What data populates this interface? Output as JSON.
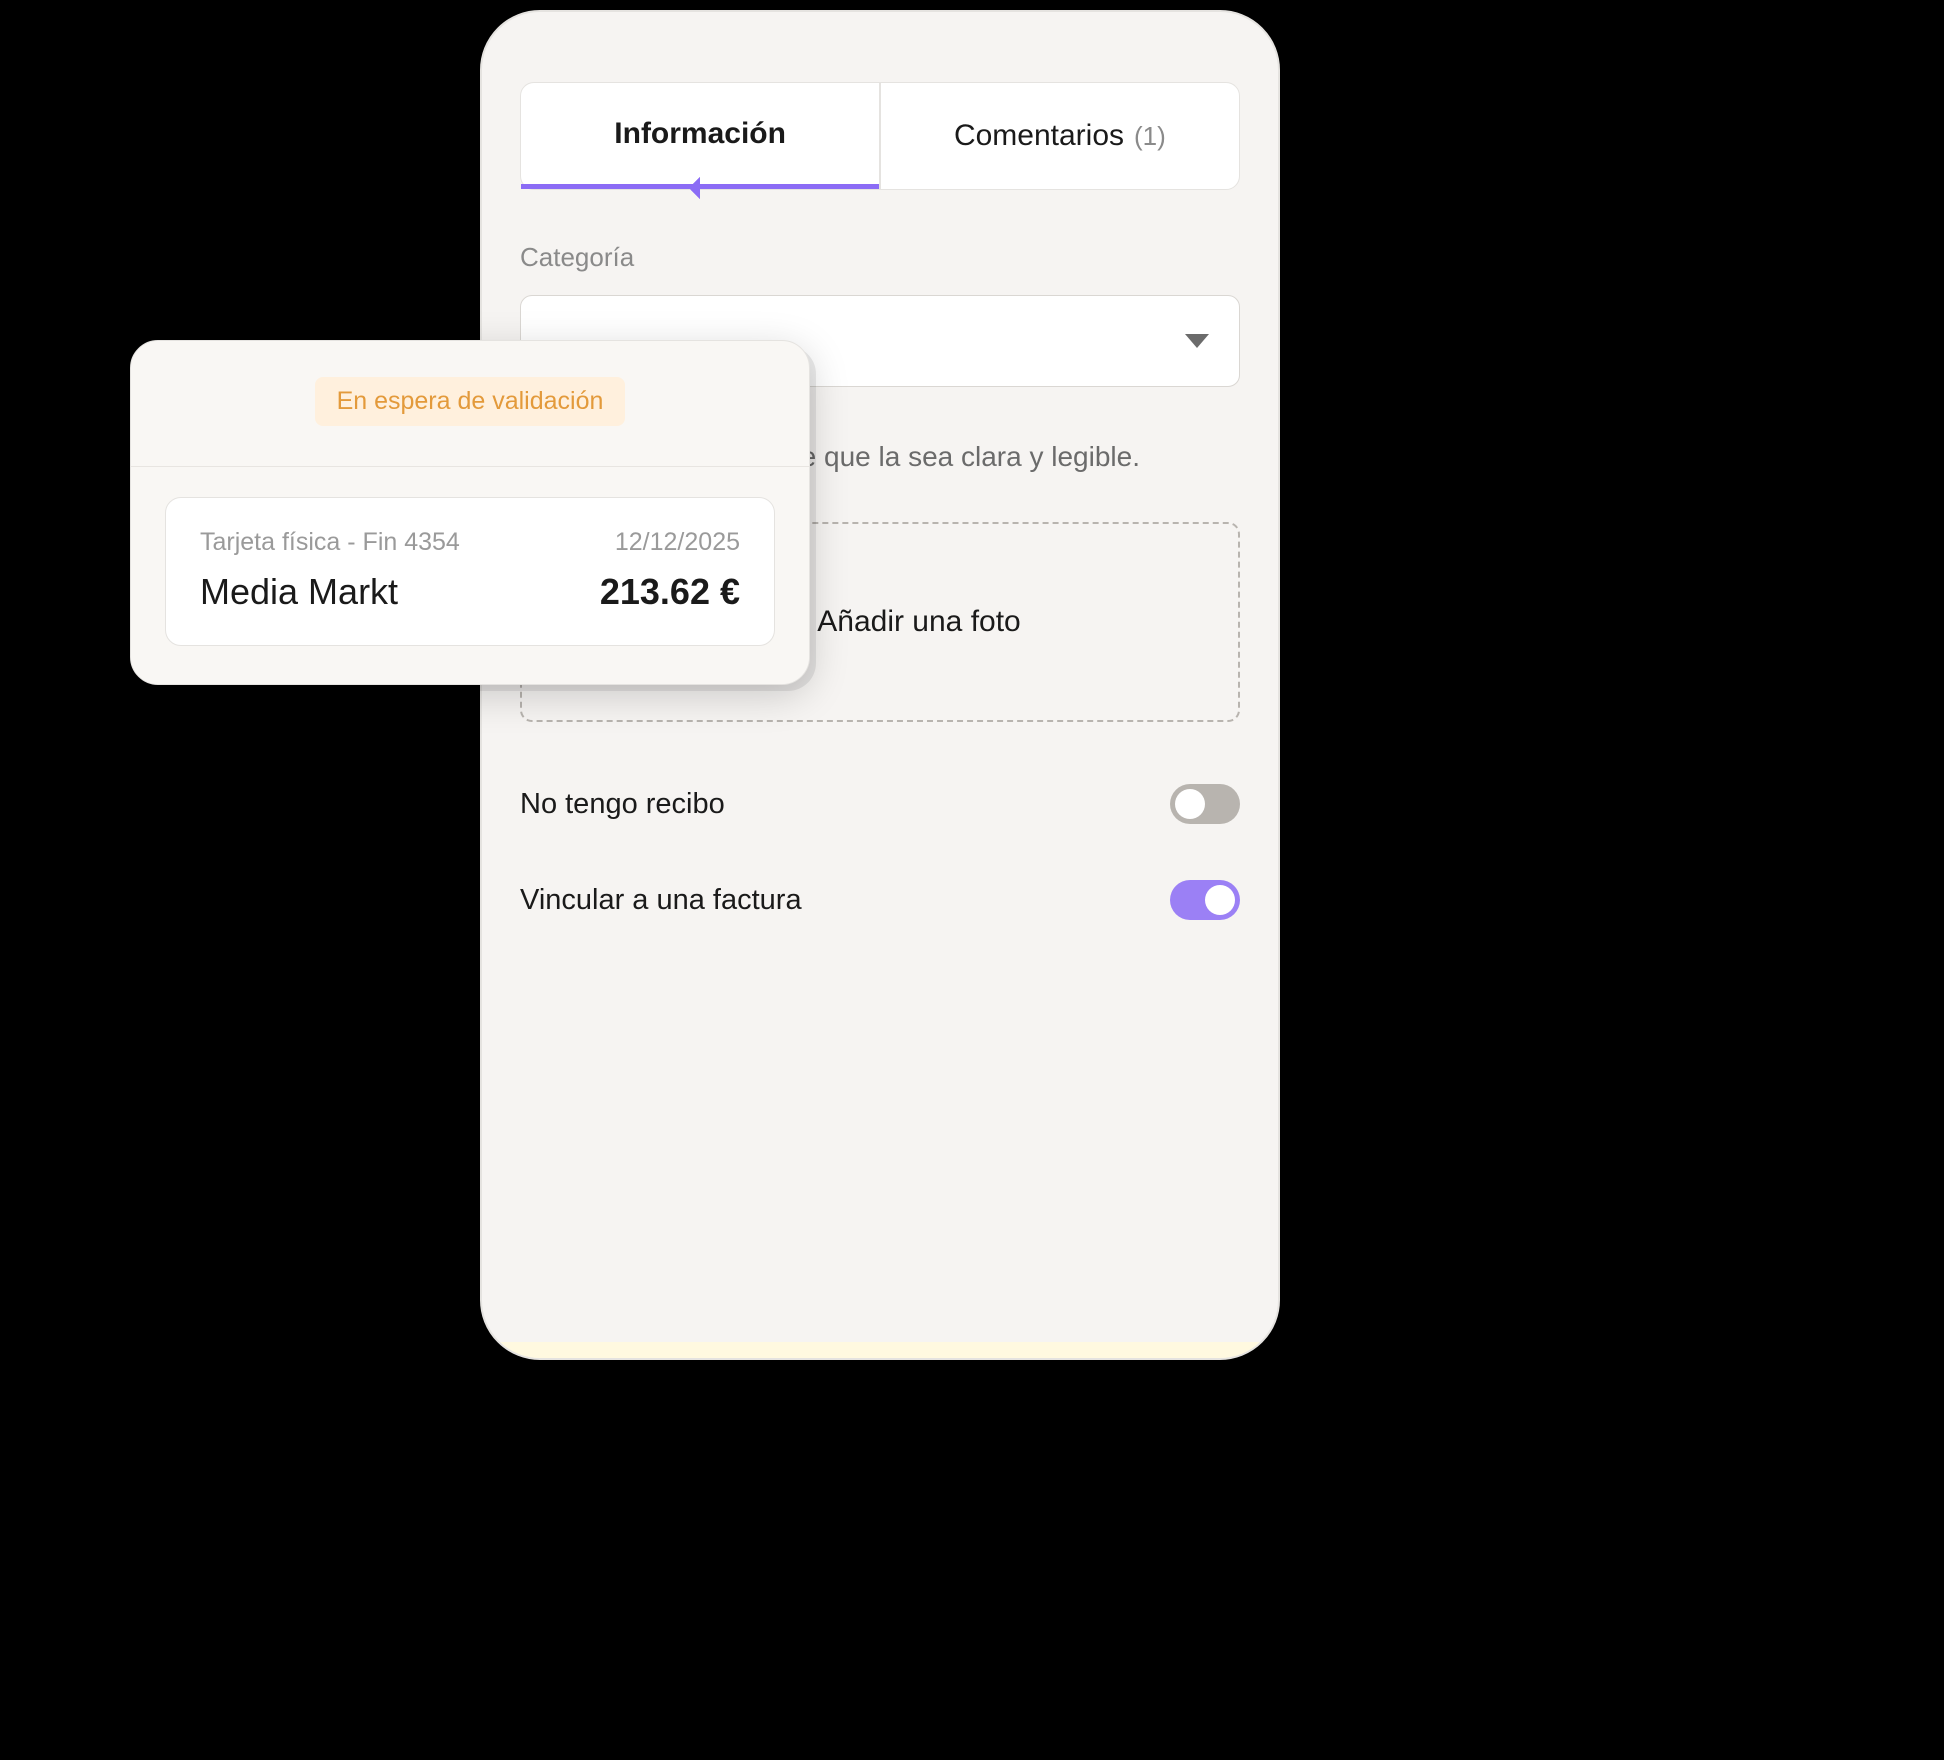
{
  "tabs": {
    "info_label": "Información",
    "comments_label": "Comentarios",
    "comments_count": "(1)"
  },
  "category": {
    "label": "Categoría"
  },
  "helper_text": "de pago y asegúrate de que la sea clara y legible.",
  "upload": {
    "label": "Añadir una foto"
  },
  "toggles": {
    "no_receipt_label": "No tengo recibo",
    "no_receipt_on": false,
    "link_invoice_label": "Vincular a una factura",
    "link_invoice_on": true
  },
  "transaction": {
    "status": "En espera de validación",
    "card_info": "Tarjeta física - Fin 4354",
    "date": "12/12/2025",
    "merchant": "Media Markt",
    "amount": "213.62 €"
  }
}
